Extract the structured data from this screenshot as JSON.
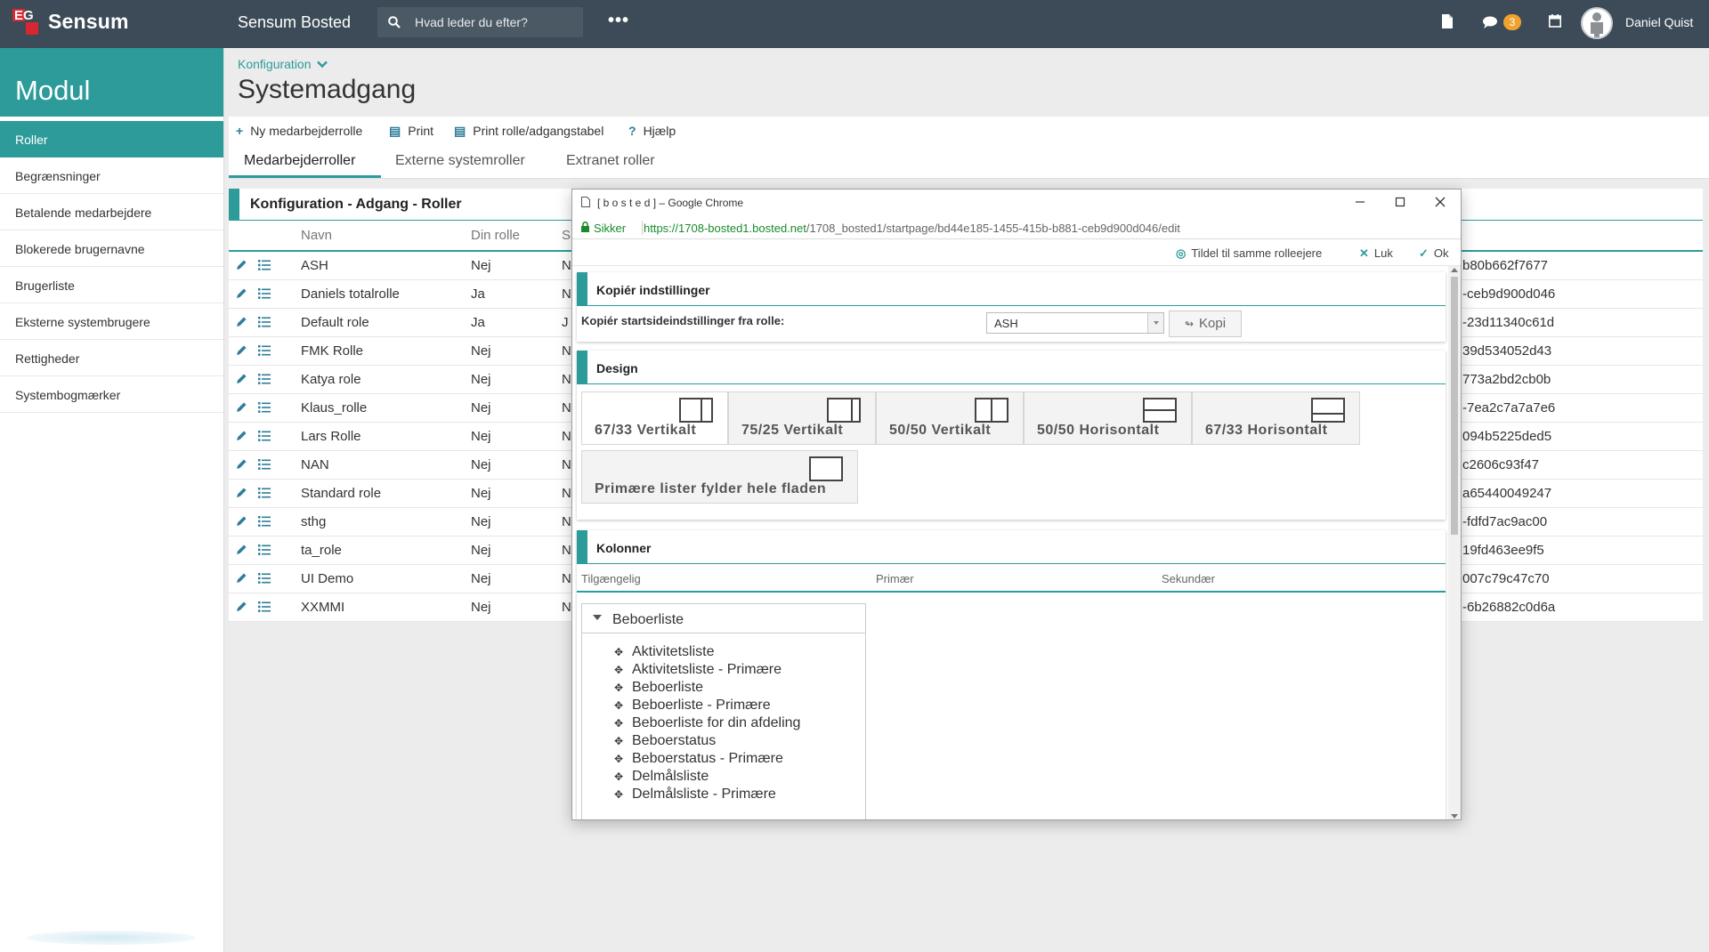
{
  "topbar": {
    "brand": "Sensum",
    "logo_text": "EG",
    "app_title": "Sensum Bosted",
    "search_placeholder": "Hvad leder du efter?",
    "more": "•••",
    "message_count": "3",
    "user_name": "Daniel Quist"
  },
  "sidebar": {
    "title": "Modul",
    "items": [
      {
        "label": "Roller",
        "active": true
      },
      {
        "label": "Begrænsninger"
      },
      {
        "label": "Betalende medarbejdere"
      },
      {
        "label": "Blokerede brugernavne"
      },
      {
        "label": "Brugerliste"
      },
      {
        "label": "Eksterne systembrugere"
      },
      {
        "label": "Rettigheder"
      },
      {
        "label": "Systembogmærker"
      }
    ]
  },
  "page": {
    "breadcrumb": "Konfiguration",
    "title": "Systemadgang"
  },
  "toolbar": {
    "new_role": "Ny medarbejderrolle",
    "print": "Print",
    "print_table": "Print rolle/adgangstabel",
    "help": "Hjælp"
  },
  "tabs": [
    "Medarbejderroller",
    "Externe systemroller",
    "Extranet roller"
  ],
  "roles_panel": {
    "title": "Konfiguration - Adgang - Roller",
    "columns": [
      "Navn",
      "Din rolle",
      "S"
    ],
    "rows": [
      {
        "name": "ASH",
        "own": "Nej",
        "c3": "N",
        "tail": "b80b662f7677"
      },
      {
        "name": "Daniels totalrolle",
        "own": "Ja",
        "c3": "N",
        "tail": "-ceb9d900d046"
      },
      {
        "name": "Default role",
        "own": "Ja",
        "c3": "J",
        "tail": "-23d11340c61d"
      },
      {
        "name": "FMK Rolle",
        "own": "Nej",
        "c3": "N",
        "tail": "39d534052d43"
      },
      {
        "name": "Katya role",
        "own": "Nej",
        "c3": "N",
        "tail": "773a2bd2cb0b"
      },
      {
        "name": "Klaus_rolle",
        "own": "Nej",
        "c3": "N",
        "tail": "-7ea2c7a7a7e6"
      },
      {
        "name": "Lars Rolle",
        "own": "Nej",
        "c3": "N",
        "tail": "094b5225ded5"
      },
      {
        "name": "NAN",
        "own": "Nej",
        "c3": "N",
        "tail": "c2606c93f47"
      },
      {
        "name": "Standard role",
        "own": "Nej",
        "c3": "N",
        "tail": "a65440049247"
      },
      {
        "name": "sthg",
        "own": "Nej",
        "c3": "N",
        "tail": "-fdfd7ac9ac00"
      },
      {
        "name": "ta_role",
        "own": "Nej",
        "c3": "N",
        "tail": "19fd463ee9f5"
      },
      {
        "name": "UI Demo",
        "own": "Nej",
        "c3": "N",
        "tail": "007c79c47c70"
      },
      {
        "name": "XXMMI",
        "own": "Nej",
        "c3": "N",
        "tail": "-6b26882c0d6a"
      }
    ]
  },
  "popup": {
    "window_title": "[ b o s t e d ] – Google Chrome",
    "secure_label": "Sikker",
    "url_host": "https://1708-bosted1.bosted.net",
    "url_path": "/1708_bosted1/startpage/bd44e185-1455-415b-b881-ceb9d900d046/edit",
    "actions": {
      "assign": "Tildel til samme rolleejere",
      "close": "Luk",
      "ok": "Ok"
    },
    "copy_section": {
      "title": "Kopiér indstillinger",
      "label": "Kopiér startsideindstillinger fra rolle:",
      "selected_role": "ASH",
      "copy_button": "Kopi"
    },
    "design_section": {
      "title": "Design",
      "layouts": [
        "67/33 Vertikalt",
        "75/25 Vertikalt",
        "50/50 Vertikalt",
        "50/50 Horisontalt",
        "67/33 Horisontalt",
        "Primære lister fylder hele fladen"
      ],
      "active_layout": "67/33 Vertikalt"
    },
    "columns_section": {
      "title": "Kolonner",
      "headers": [
        "Tilgængelig",
        "Primær",
        "Sekundær"
      ],
      "group": "Beboerliste",
      "items": [
        "Aktivitetsliste",
        "Aktivitetsliste - Primære",
        "Beboerliste",
        "Beboerliste - Primære",
        "Beboerliste for din afdeling",
        "Beboerstatus",
        "Beboerstatus - Primære",
        "Delmålsliste",
        "Delmålsliste - Primære"
      ]
    }
  },
  "colors": {
    "topbar": "#3c4b57",
    "accent": "#2e9b9b",
    "logo_red": "#d7282f",
    "badge": "#f0a22e"
  }
}
